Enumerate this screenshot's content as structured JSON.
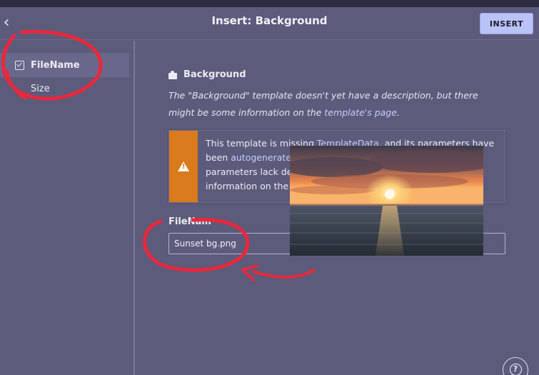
{
  "header": {
    "back_icon": "chevron-left-icon",
    "title": "Insert: Background",
    "insert_label": "INSERT"
  },
  "sidebar": {
    "items": [
      {
        "label": "FileName",
        "checked": true,
        "active": true
      },
      {
        "label": "Size",
        "checked": false,
        "active": false
      }
    ]
  },
  "template": {
    "icon": "puzzle-icon",
    "name": "Background",
    "description_pre": "The \"Background\" template doesn't yet have a description, but there might be some information on the ",
    "description_link": "template's page",
    "description_post": "."
  },
  "notice": {
    "icon": "warning-icon",
    "color": "#d97a1c",
    "line1_pre": "This template is missing ",
    "line1_link": "TemplateData",
    "line1_post": ", and its parameters have",
    "line2_pre": "been ",
    "line2_link": "autogenerate",
    "line3": "parameters lack de",
    "line4": "information on the"
  },
  "field": {
    "label": "FileNam",
    "value": "Sunset bg.png"
  },
  "help": {
    "icon": "help-icon",
    "glyph": "?"
  },
  "photo": {
    "subject": "sunset-over-sea-image"
  },
  "annotation_color": "#e8283c"
}
